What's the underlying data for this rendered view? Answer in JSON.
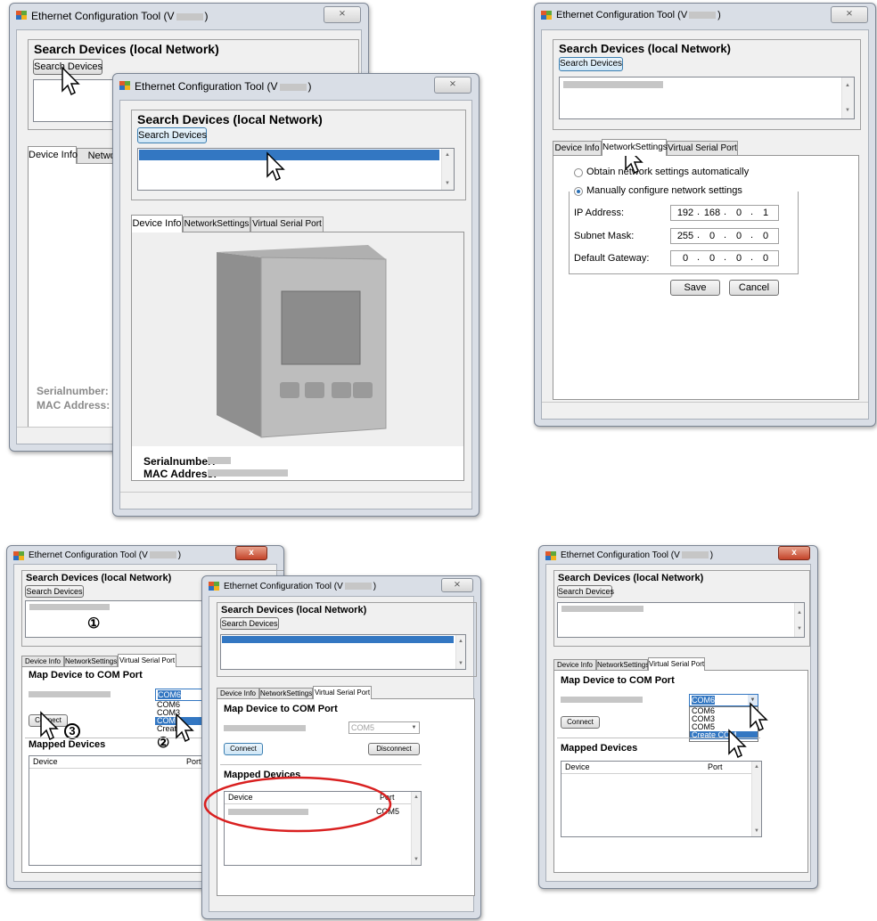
{
  "app_title": "Ethernet Configuration Tool (V",
  "app_title_end": ")",
  "close_label": "⨯",
  "close_x": "x",
  "search_group_title": "Search Devices (local Network)",
  "search_button": "Search Devices",
  "tabs": {
    "device_info": "Device Info",
    "network_settings": "NetworkSettings",
    "virtual_serial_port": "Virtual Serial Port",
    "network_cut": "Networ"
  },
  "device_info": {
    "serial_label": "Serialnumber:",
    "mac_label": "MAC Address:"
  },
  "network": {
    "obtain_label": "Obtain network settings automatically",
    "manual_label": "Manually configure network settings",
    "ip_label": "IP Address:",
    "subnet_label": "Subnet Mask:",
    "gateway_label": "Default Gateway:",
    "ip": [
      "192",
      "168",
      "0",
      "1"
    ],
    "subnet": [
      "255",
      "0",
      "0",
      "0"
    ],
    "gateway": [
      "0",
      "0",
      "0",
      "0"
    ],
    "save": "Save",
    "cancel": "Cancel"
  },
  "vsp": {
    "map_title": "Map Device to COM Port",
    "connect": "Connect",
    "disconnect": "Disconnect",
    "mapped_title": "Mapped Devices",
    "col_device": "Device",
    "col_port": "Port",
    "combo_value": "COM6",
    "combo_value_b": "COM5",
    "mapped_port": "COM5",
    "dropdown_a": [
      "COM6",
      "COM3",
      "COM5",
      "Create"
    ],
    "dropdown_b": [
      "COM6",
      "COM3",
      "COM5",
      "Create COM"
    ]
  },
  "steps": {
    "one": "①",
    "two": "②",
    "three": "3"
  }
}
